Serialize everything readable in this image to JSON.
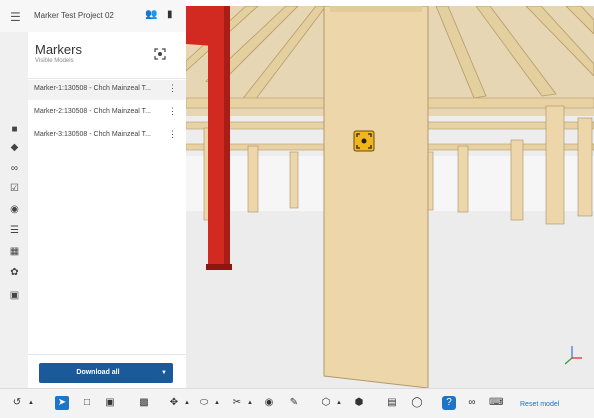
{
  "header": {
    "project_name": "Marker Test Project 02",
    "menu_icon": "hamburger-icon",
    "add_user_icon": "add-user-icon",
    "folder_icon": "folder-icon"
  },
  "left_rail": {
    "icons": [
      "cube-icon",
      "layers-icon",
      "link-icon",
      "checklist-icon",
      "camera-icon",
      "list-icon",
      "table-icon",
      "settings-icon",
      "marker-focus-icon"
    ]
  },
  "panel": {
    "title": "Markers",
    "subtitle": "Visible Models",
    "header_icon": "marker-focus-icon",
    "markers": [
      {
        "label": "Marker-1:130508 - Chch Mainzeal T..."
      },
      {
        "label": "Marker-2:130508 - Chch Mainzeal T..."
      },
      {
        "label": "Marker-3:130508 - Chch Mainzeal T..."
      }
    ],
    "download_label": "Download all"
  },
  "toolbar": {
    "reset_label": "Reset model"
  },
  "colors": {
    "accent": "#1e74c6",
    "download_button": "#1a5a9a",
    "column": "#ecd6aa",
    "beam": "#e8d2a4",
    "red_column": "#d22a21",
    "marker": "#f2b51c"
  }
}
